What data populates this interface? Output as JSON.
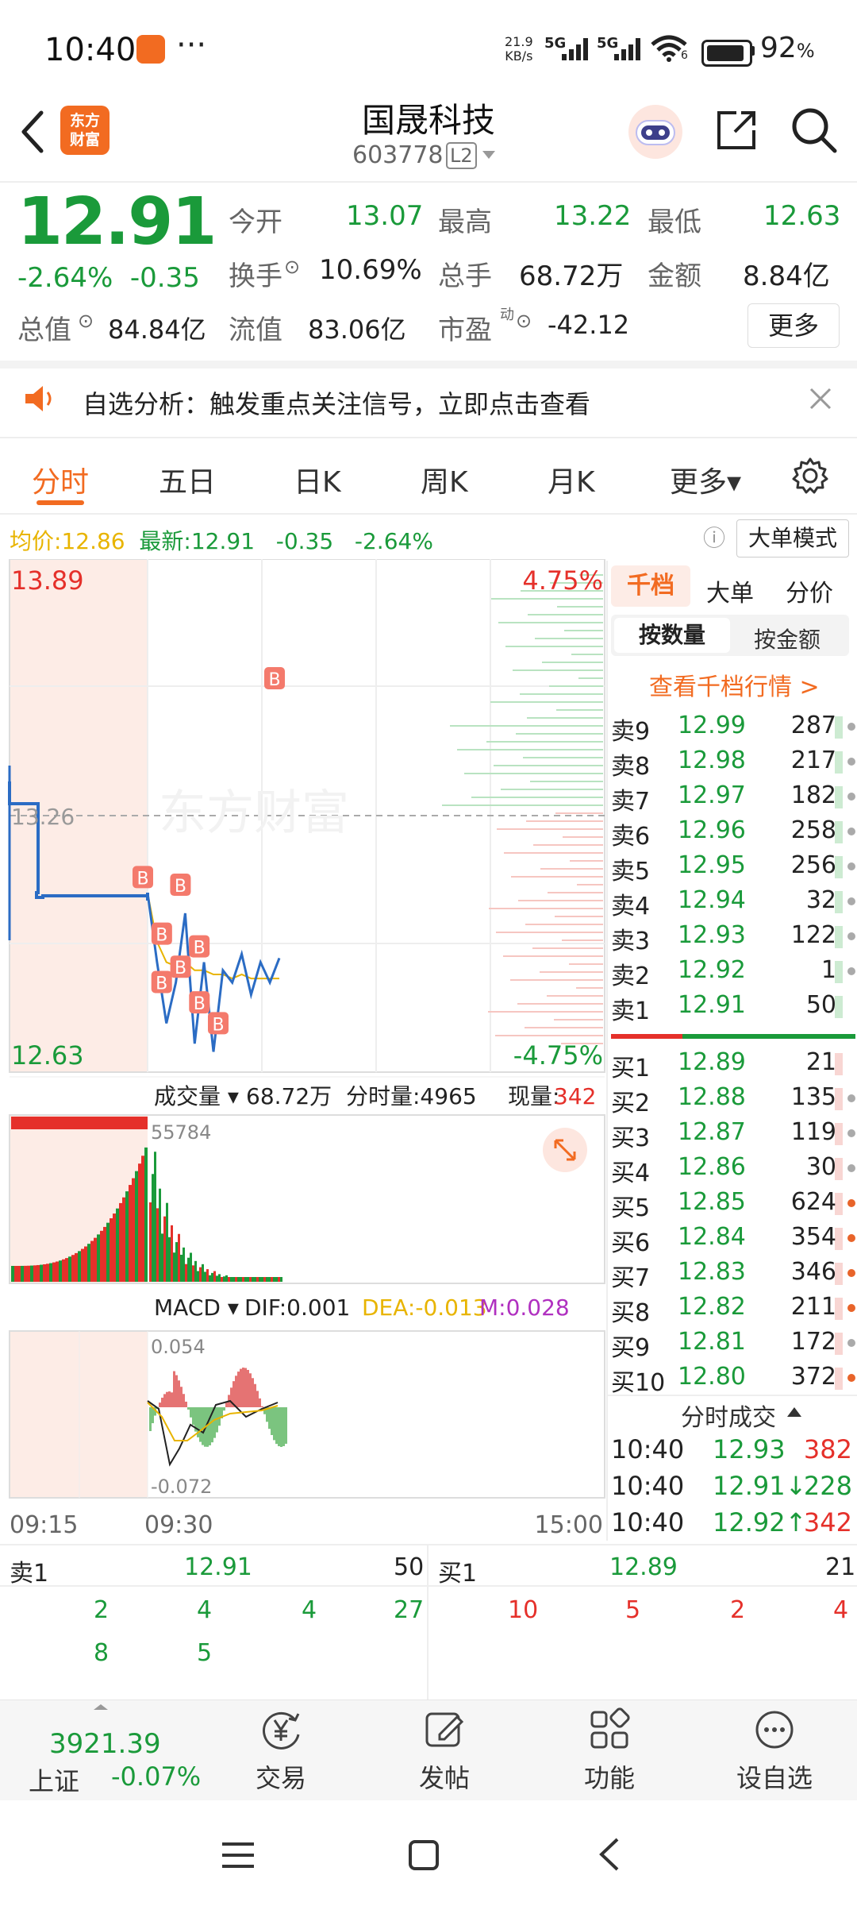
{
  "status_bar": {
    "time": "10:40",
    "dots": "···",
    "net_rate": "21.9",
    "net_unit": "KB/s",
    "net1": "5G",
    "net2": "5G",
    "wifi_num": "6",
    "battery": "92",
    "battery_unit": "%"
  },
  "header": {
    "logo_text": "东方财富",
    "title": "国晟科技",
    "code": "603778",
    "level": "L2"
  },
  "quote": {
    "price": "12.91",
    "change_pct": "-2.64%",
    "change_amt": "-0.35",
    "open_label": "今开",
    "open": "13.07",
    "high_label": "最高",
    "high": "13.22",
    "low_label": "最低",
    "low": "12.63",
    "turnover_label": "换手",
    "turnover": "10.69%",
    "volume_label": "总手",
    "volume": "68.72万",
    "amount_label": "金额",
    "amount": "8.84亿",
    "mktcap_label": "总值",
    "mktcap": "84.84亿",
    "float_label": "流值",
    "float": "83.06亿",
    "pe_label": "市盈",
    "pe_sup": "动",
    "pe": "-42.12",
    "more": "更多"
  },
  "notice": {
    "text": "自选分析：触发重点关注信号，立即点击查看"
  },
  "tabs": [
    {
      "label": "分时",
      "active": true
    },
    {
      "label": "五日"
    },
    {
      "label": "日K"
    },
    {
      "label": "周K"
    },
    {
      "label": "月K"
    },
    {
      "label": "更多▾"
    }
  ],
  "info": {
    "avg_label": "均价:",
    "avg": "12.86",
    "last_label": "最新:",
    "last": "12.91",
    "chg": "-0.35",
    "pct": "-2.64%",
    "big_order": "大单模式"
  },
  "chart": {
    "price_high": "13.89",
    "price_low": "12.63",
    "pct_high": "4.75%",
    "pct_low": "-4.75%",
    "pre_close": "13.26",
    "vol_label": "成交量 ▾",
    "vol_total": "68.72万",
    "vol_minute": "分时量:4965",
    "vol_now_label": "现量:",
    "vol_now": "342",
    "vol_max": "55784",
    "macd_label": "MACD ▾",
    "dif": "DIF:0.001",
    "dea": "DEA:-0.013",
    "m": "M:0.028",
    "macd_high": "0.054",
    "macd_low": "-0.072",
    "time_start": "09:15",
    "time_open": "09:30",
    "time_end": "15:00",
    "watermark": "东方财富",
    "marker": "B",
    "colors": {
      "up": "#e5302a",
      "down": "#1a9a3a",
      "line": "#2b6cc4",
      "avg": "#e8b400"
    }
  },
  "chart_data": {
    "type": "line",
    "title": "",
    "x": [
      "09:30",
      "09:35",
      "09:40",
      "09:45",
      "09:50",
      "09:55",
      "10:00",
      "10:05",
      "10:10",
      "10:15",
      "10:20",
      "10:25",
      "10:30",
      "10:35",
      "10:40"
    ],
    "series": [
      {
        "name": "最新",
        "values": [
          13.07,
          12.9,
          12.75,
          12.85,
          13.02,
          12.7,
          12.9,
          12.68,
          12.88,
          12.85,
          12.92,
          12.82,
          12.9,
          12.85,
          12.91
        ]
      },
      {
        "name": "均价",
        "values": [
          13.07,
          12.95,
          12.9,
          12.89,
          12.9,
          12.88,
          12.88,
          12.87,
          12.87,
          12.86,
          12.87,
          12.86,
          12.86,
          12.86,
          12.86
        ]
      }
    ],
    "ylim": [
      12.63,
      13.89
    ]
  },
  "book": {
    "tab_depth": "千档",
    "tab_big": "大单",
    "tab_price": "分价",
    "by_qty": "按数量",
    "by_amt": "按金额",
    "view_depth": "查看千档行情 >",
    "asks": [
      {
        "label": "卖9",
        "price": "12.99",
        "qty": "287"
      },
      {
        "label": "卖8",
        "price": "12.98",
        "qty": "217"
      },
      {
        "label": "卖7",
        "price": "12.97",
        "qty": "182"
      },
      {
        "label": "卖6",
        "price": "12.96",
        "qty": "258"
      },
      {
        "label": "卖5",
        "price": "12.95",
        "qty": "256"
      },
      {
        "label": "卖4",
        "price": "12.94",
        "qty": "32"
      },
      {
        "label": "卖3",
        "price": "12.93",
        "qty": "122"
      },
      {
        "label": "卖2",
        "price": "12.92",
        "qty": "1"
      },
      {
        "label": "卖1",
        "price": "12.91",
        "qty": "50"
      }
    ],
    "bids": [
      {
        "label": "买1",
        "price": "12.89",
        "qty": "21"
      },
      {
        "label": "买2",
        "price": "12.88",
        "qty": "135"
      },
      {
        "label": "买3",
        "price": "12.87",
        "qty": "119"
      },
      {
        "label": "买4",
        "price": "12.86",
        "qty": "30"
      },
      {
        "label": "买5",
        "price": "12.85",
        "qty": "624"
      },
      {
        "label": "买6",
        "price": "12.84",
        "qty": "354"
      },
      {
        "label": "买7",
        "price": "12.83",
        "qty": "346"
      },
      {
        "label": "买8",
        "price": "12.82",
        "qty": "211"
      },
      {
        "label": "买9",
        "price": "12.81",
        "qty": "172"
      },
      {
        "label": "买10",
        "price": "12.80",
        "qty": "372"
      }
    ],
    "ticks_title": "分时成交",
    "ticks": [
      {
        "time": "10:40",
        "price": "12.93",
        "qty": "382",
        "dir": ""
      },
      {
        "time": "10:40",
        "price": "12.91↓",
        "qty": "228",
        "dir": "down"
      },
      {
        "time": "10:40",
        "price": "12.92↑",
        "qty": "342",
        "dir": "up"
      }
    ]
  },
  "bottom_book": {
    "ask_label": "卖1",
    "ask_price": "12.91",
    "ask_qty": "50",
    "bid_label": "买1",
    "bid_price": "12.89",
    "bid_qty": "21",
    "ask_orders_row1": [
      "2",
      "4",
      "4",
      "27"
    ],
    "ask_orders_row2": [
      "8",
      "5"
    ],
    "bid_orders_row1": [
      "10",
      "5",
      "2",
      "4"
    ]
  },
  "bottom_nav": {
    "index_value": "3921.39",
    "index_name": "上证",
    "index_chg": "-0.07%",
    "trade": "交易",
    "post": "发帖",
    "func": "功能",
    "watch": "设自选"
  }
}
